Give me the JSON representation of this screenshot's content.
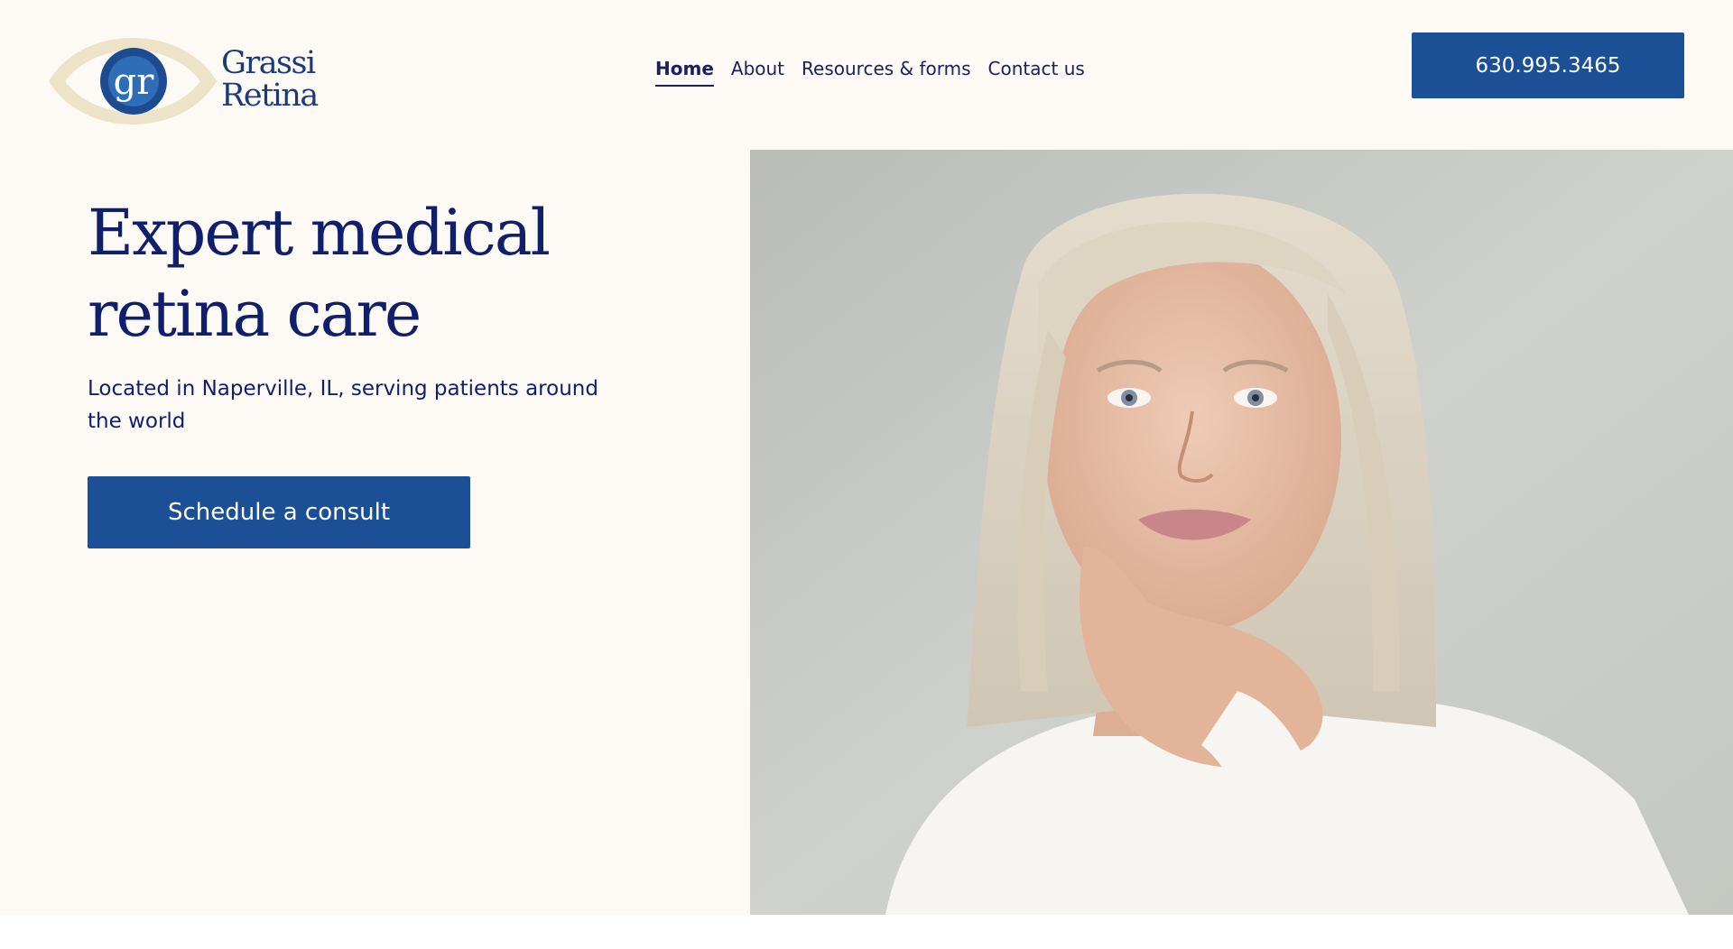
{
  "logo": {
    "monogram": "gr",
    "line1": "Grassi",
    "line2": "Retina"
  },
  "nav": {
    "items": [
      {
        "label": "Home",
        "active": true
      },
      {
        "label": "About",
        "active": false
      },
      {
        "label": "Resources & forms",
        "active": false
      },
      {
        "label": "Contact us",
        "active": false
      }
    ]
  },
  "header": {
    "phone": "630.995.3465"
  },
  "hero": {
    "title": "Expert medical retina care",
    "subtitle": "Located in Naperville, IL, serving patients around the world",
    "cta_label": "Schedule a consult",
    "photo_subject": "portrait-photo"
  },
  "colors": {
    "background": "#fdf9f4",
    "navy_text": "#101f6b",
    "button_blue": "#1b5096",
    "logo_gold": "#e8dfc6",
    "logo_blue": "#1d3a78"
  }
}
